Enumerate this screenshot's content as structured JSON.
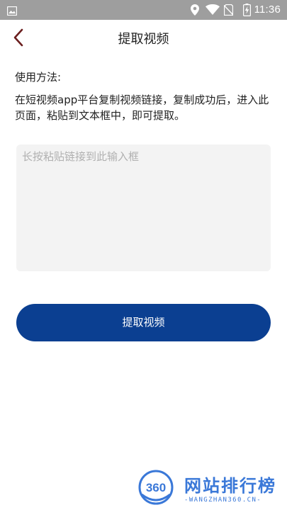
{
  "status_bar": {
    "time": "11:36",
    "icons": [
      "image-icon",
      "location-icon",
      "wifi-icon",
      "no-sim-icon",
      "battery-charging-icon"
    ]
  },
  "header": {
    "back_icon": "chevron-left-icon",
    "title": "提取视频"
  },
  "instructions": {
    "label": "使用方法:",
    "text": "在短视频app平台复制视频链接，复制成功后，进入此页面，粘贴到文本框中，即可提取。"
  },
  "link_input": {
    "value": "",
    "placeholder": "长按粘贴链接到此输入框"
  },
  "submit_button": {
    "label": "提取视频"
  },
  "watermark": {
    "logo_number": "360",
    "title": "网站排行榜",
    "subtitle": "-WANGZHAN360.CN-"
  },
  "colors": {
    "status_bar": "#9e9e9e",
    "primary_button": "#0b3f91",
    "input_background": "#f3f3f3",
    "back_arrow": "#6b1f1f",
    "watermark": "#3a78d8"
  }
}
